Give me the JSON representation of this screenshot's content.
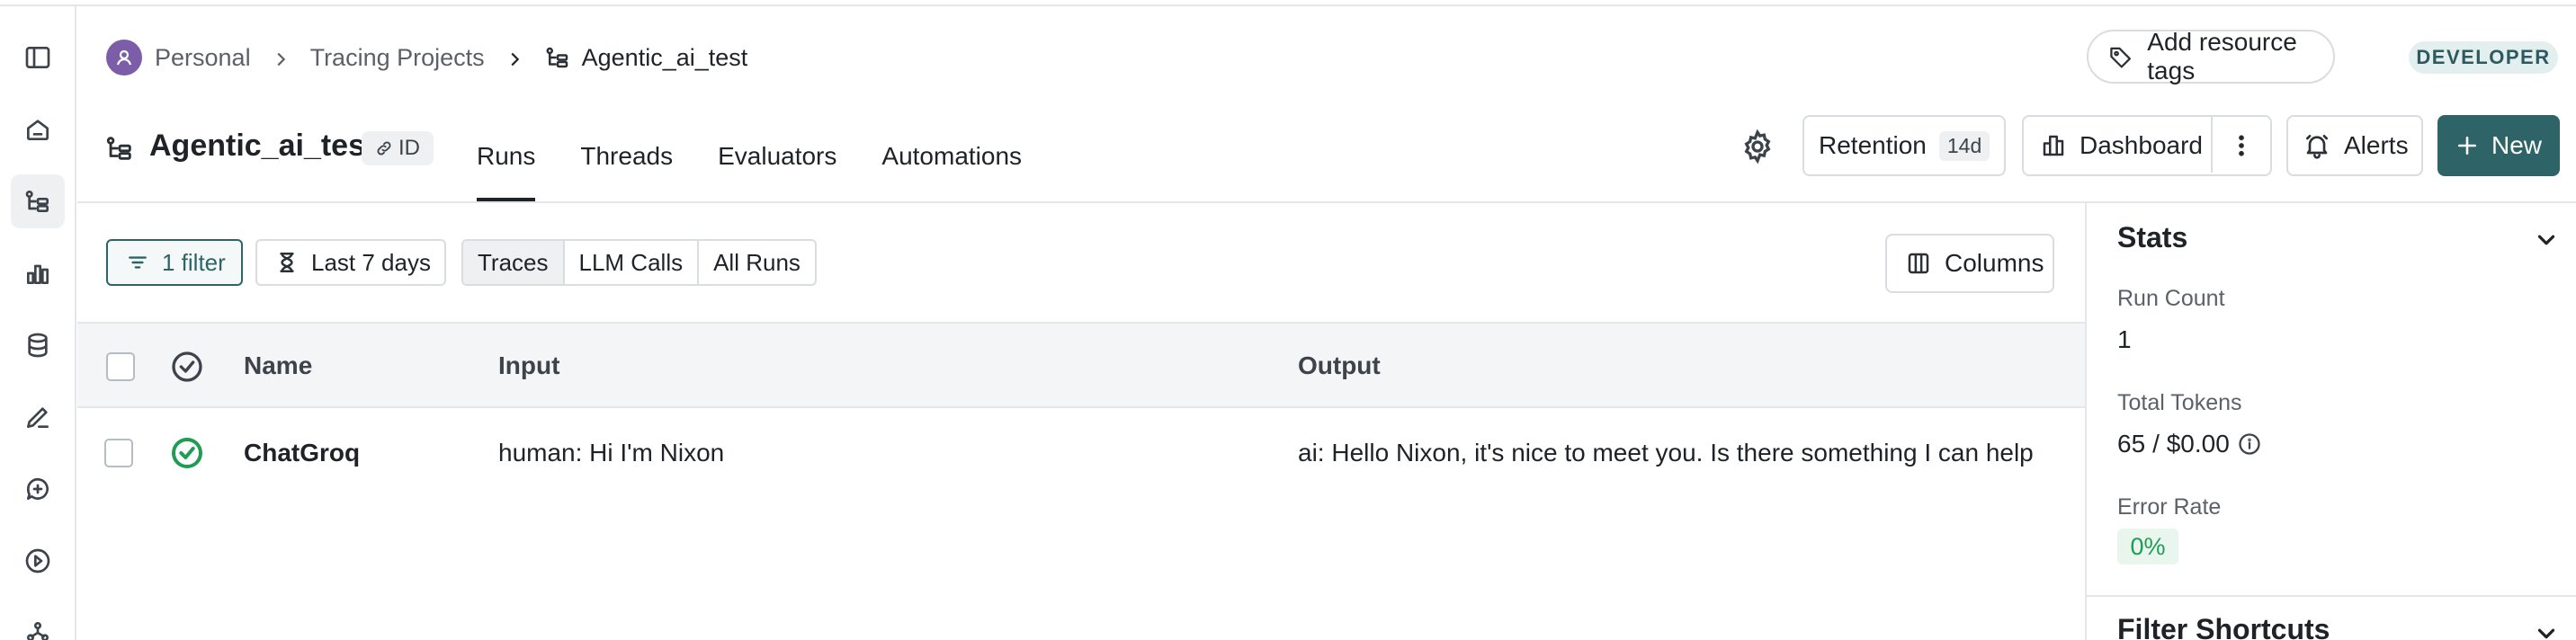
{
  "breadcrumb": {
    "items": [
      "Personal",
      "Tracing Projects",
      "Agentic_ai_test"
    ]
  },
  "header": {
    "add_tags_label": "Add resource tags",
    "badge": "DEVELOPER"
  },
  "project": {
    "title": "Agentic_ai_test",
    "id_label": "ID"
  },
  "tabs": [
    "Runs",
    "Threads",
    "Evaluators",
    "Automations"
  ],
  "actions": {
    "retention_label": "Retention",
    "retention_value": "14d",
    "dashboard_label": "Dashboard",
    "alerts_label": "Alerts",
    "new_label": "New"
  },
  "toolbar": {
    "filter_label": "1 filter",
    "time_label": "Last 7 days",
    "run_types": [
      "Traces",
      "LLM Calls",
      "All Runs"
    ],
    "columns_label": "Columns"
  },
  "table": {
    "columns": [
      "Name",
      "Input",
      "Output"
    ],
    "rows": [
      {
        "name": "ChatGroq",
        "input": "human: Hi I'm Nixon",
        "output": "ai: Hello Nixon, it's nice to meet you. Is there something I can help"
      }
    ]
  },
  "stats": {
    "title": "Stats",
    "run_count_label": "Run Count",
    "run_count": "1",
    "tokens_label": "Total Tokens",
    "tokens_value": "65",
    "cost_value": "/ $0.00",
    "error_rate_label": "Error Rate",
    "error_rate": "0%",
    "filter_shortcuts_title": "Filter Shortcuts"
  },
  "colors": {
    "accent": "#2e6468",
    "success": "#1f9d55",
    "badge_bg": "#e3eeee"
  }
}
